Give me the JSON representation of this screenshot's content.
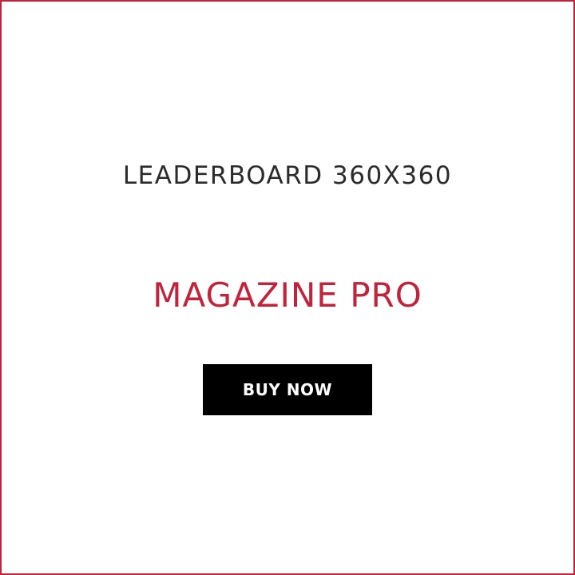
{
  "ad": {
    "size_label": "LEADERBOARD 360X360",
    "brand": "MAGAZINE PRO",
    "cta_label": "BUY NOW"
  },
  "colors": {
    "accent": "#c0233a",
    "text_dark": "#2b2b2b",
    "button_bg": "#000000",
    "button_text": "#ffffff",
    "background": "#ffffff"
  }
}
